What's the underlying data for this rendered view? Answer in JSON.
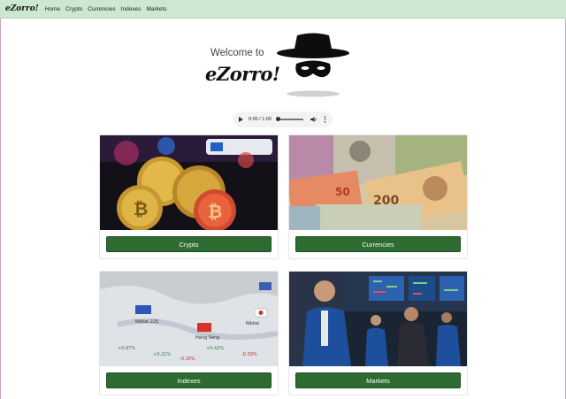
{
  "nav": {
    "brand": "eZorro!",
    "links": [
      "Home",
      "Crypto",
      "Currencies",
      "Indexes",
      "Markets"
    ]
  },
  "hero": {
    "welcome": "Welcome to",
    "logo": "eZorro!"
  },
  "audio": {
    "time": "0:00 / 1:00",
    "progress": 0
  },
  "cards": [
    {
      "label": "Crypto"
    },
    {
      "label": "Currencies"
    },
    {
      "label": "Indexes"
    },
    {
      "label": "Markets"
    }
  ],
  "colors": {
    "navbar": "#cde7d1",
    "button": "#2e6b30"
  }
}
